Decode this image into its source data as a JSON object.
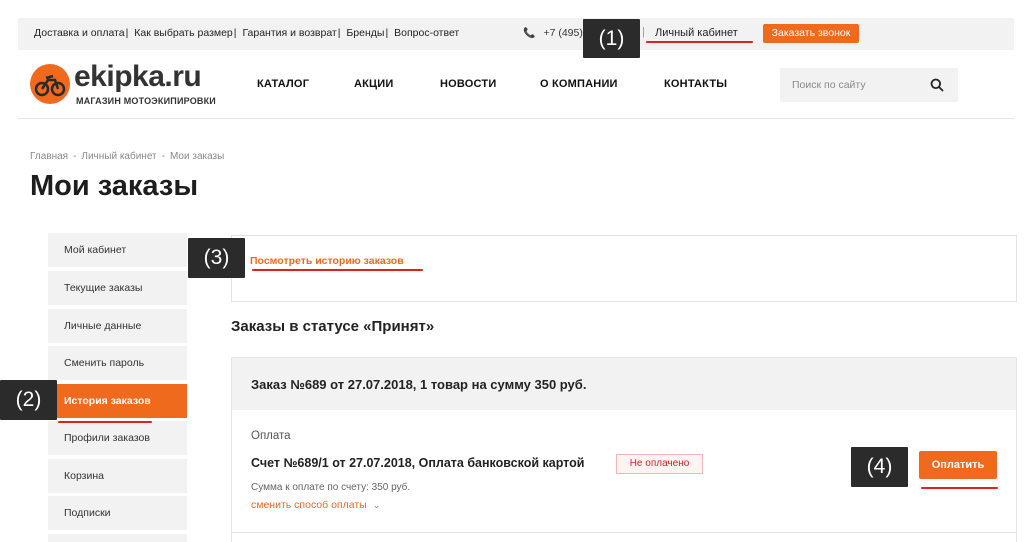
{
  "topbar": {
    "links": [
      "Доставка и оплата",
      "Как выбрать размер",
      "Гарантия и возврат",
      "Бренды",
      "Вопрос-ответ"
    ],
    "phone": "+7 (495)",
    "account_link": "Личный кабинет",
    "callback_button": "Заказать звонок"
  },
  "header": {
    "logo_name": "ekipka.ru",
    "logo_tagline": "МАГАЗИН МОТОЭКИПИРОВКИ",
    "nav": [
      "КАТАЛОГ",
      "АКЦИИ",
      "НОВОСТИ",
      "О КОМПАНИИ",
      "КОНТАКТЫ"
    ],
    "search_placeholder": "Поиск по сайту"
  },
  "breadcrumb": [
    "Главная",
    "Личный кабинет",
    "Мои заказы"
  ],
  "breadcrumb_separator": "-",
  "page_title": "Мои заказы",
  "sidebar": {
    "items": [
      "Мой кабинет",
      "Текущие заказы",
      "Личные данные",
      "Сменить пароль",
      "История заказов",
      "Профили заказов",
      "Корзина",
      "Подписки"
    ],
    "active_index": 4
  },
  "main": {
    "history_link": "Посмотреть историю заказов",
    "status_heading": "Заказы в статусе «Принят»",
    "order": {
      "title": "Заказ №689 от 27.07.2018, 1 товар на сумму 350 руб.",
      "payment_label": "Оплата",
      "invoice": "Счет №689/1 от 27.07.2018, Оплата банковской картой",
      "status_badge": "Не оплачено",
      "amount_due": "Сумма к оплате по счету: 350 руб.",
      "change_payment": "сменить способ оплаты",
      "pay_button": "Оплатить"
    }
  },
  "annotations": [
    "(1)",
    "(2)",
    "(3)",
    "(4)"
  ],
  "colors": {
    "accent": "#f06a1e",
    "annotation_bg": "#2b2b2b",
    "underline": "#e0211b"
  }
}
